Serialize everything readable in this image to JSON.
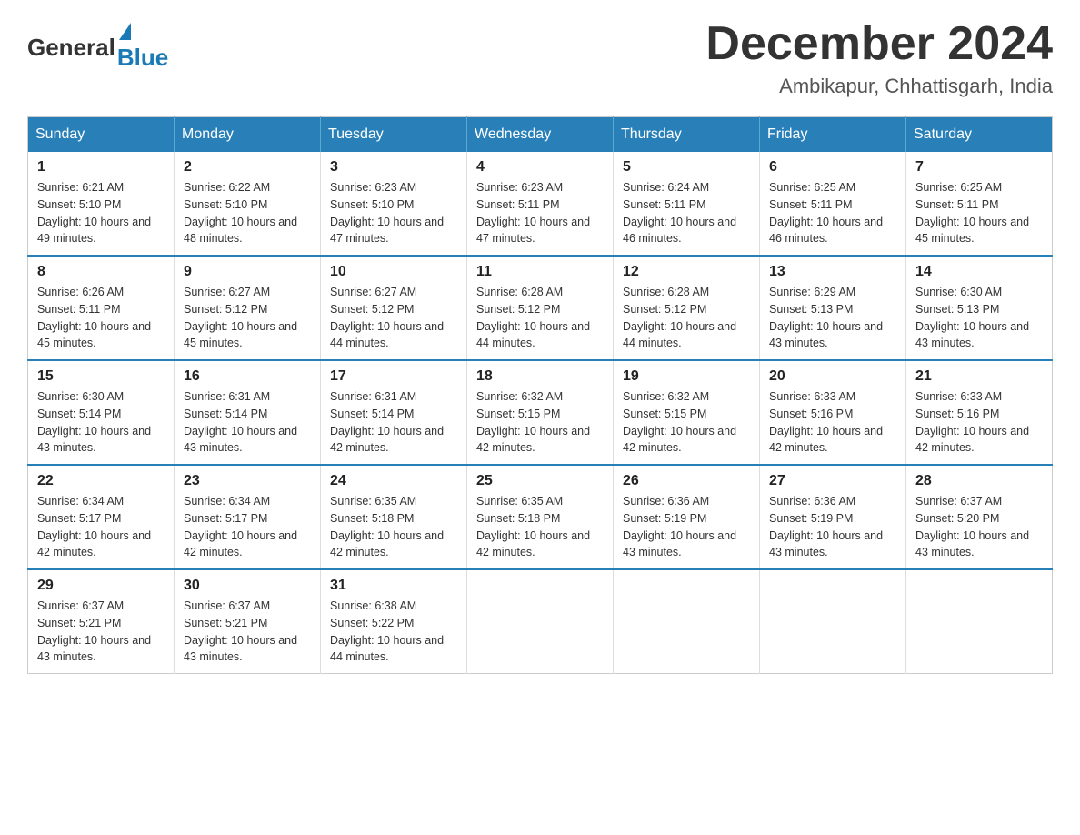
{
  "header": {
    "logo_general": "General",
    "logo_blue": "Blue",
    "month_title": "December 2024",
    "location": "Ambikapur, Chhattisgarh, India"
  },
  "weekdays": [
    "Sunday",
    "Monday",
    "Tuesday",
    "Wednesday",
    "Thursday",
    "Friday",
    "Saturday"
  ],
  "weeks": [
    [
      {
        "day": "1",
        "sunrise": "Sunrise: 6:21 AM",
        "sunset": "Sunset: 5:10 PM",
        "daylight": "Daylight: 10 hours and 49 minutes."
      },
      {
        "day": "2",
        "sunrise": "Sunrise: 6:22 AM",
        "sunset": "Sunset: 5:10 PM",
        "daylight": "Daylight: 10 hours and 48 minutes."
      },
      {
        "day": "3",
        "sunrise": "Sunrise: 6:23 AM",
        "sunset": "Sunset: 5:10 PM",
        "daylight": "Daylight: 10 hours and 47 minutes."
      },
      {
        "day": "4",
        "sunrise": "Sunrise: 6:23 AM",
        "sunset": "Sunset: 5:11 PM",
        "daylight": "Daylight: 10 hours and 47 minutes."
      },
      {
        "day": "5",
        "sunrise": "Sunrise: 6:24 AM",
        "sunset": "Sunset: 5:11 PM",
        "daylight": "Daylight: 10 hours and 46 minutes."
      },
      {
        "day": "6",
        "sunrise": "Sunrise: 6:25 AM",
        "sunset": "Sunset: 5:11 PM",
        "daylight": "Daylight: 10 hours and 46 minutes."
      },
      {
        "day": "7",
        "sunrise": "Sunrise: 6:25 AM",
        "sunset": "Sunset: 5:11 PM",
        "daylight": "Daylight: 10 hours and 45 minutes."
      }
    ],
    [
      {
        "day": "8",
        "sunrise": "Sunrise: 6:26 AM",
        "sunset": "Sunset: 5:11 PM",
        "daylight": "Daylight: 10 hours and 45 minutes."
      },
      {
        "day": "9",
        "sunrise": "Sunrise: 6:27 AM",
        "sunset": "Sunset: 5:12 PM",
        "daylight": "Daylight: 10 hours and 45 minutes."
      },
      {
        "day": "10",
        "sunrise": "Sunrise: 6:27 AM",
        "sunset": "Sunset: 5:12 PM",
        "daylight": "Daylight: 10 hours and 44 minutes."
      },
      {
        "day": "11",
        "sunrise": "Sunrise: 6:28 AM",
        "sunset": "Sunset: 5:12 PM",
        "daylight": "Daylight: 10 hours and 44 minutes."
      },
      {
        "day": "12",
        "sunrise": "Sunrise: 6:28 AM",
        "sunset": "Sunset: 5:12 PM",
        "daylight": "Daylight: 10 hours and 44 minutes."
      },
      {
        "day": "13",
        "sunrise": "Sunrise: 6:29 AM",
        "sunset": "Sunset: 5:13 PM",
        "daylight": "Daylight: 10 hours and 43 minutes."
      },
      {
        "day": "14",
        "sunrise": "Sunrise: 6:30 AM",
        "sunset": "Sunset: 5:13 PM",
        "daylight": "Daylight: 10 hours and 43 minutes."
      }
    ],
    [
      {
        "day": "15",
        "sunrise": "Sunrise: 6:30 AM",
        "sunset": "Sunset: 5:14 PM",
        "daylight": "Daylight: 10 hours and 43 minutes."
      },
      {
        "day": "16",
        "sunrise": "Sunrise: 6:31 AM",
        "sunset": "Sunset: 5:14 PM",
        "daylight": "Daylight: 10 hours and 43 minutes."
      },
      {
        "day": "17",
        "sunrise": "Sunrise: 6:31 AM",
        "sunset": "Sunset: 5:14 PM",
        "daylight": "Daylight: 10 hours and 42 minutes."
      },
      {
        "day": "18",
        "sunrise": "Sunrise: 6:32 AM",
        "sunset": "Sunset: 5:15 PM",
        "daylight": "Daylight: 10 hours and 42 minutes."
      },
      {
        "day": "19",
        "sunrise": "Sunrise: 6:32 AM",
        "sunset": "Sunset: 5:15 PM",
        "daylight": "Daylight: 10 hours and 42 minutes."
      },
      {
        "day": "20",
        "sunrise": "Sunrise: 6:33 AM",
        "sunset": "Sunset: 5:16 PM",
        "daylight": "Daylight: 10 hours and 42 minutes."
      },
      {
        "day": "21",
        "sunrise": "Sunrise: 6:33 AM",
        "sunset": "Sunset: 5:16 PM",
        "daylight": "Daylight: 10 hours and 42 minutes."
      }
    ],
    [
      {
        "day": "22",
        "sunrise": "Sunrise: 6:34 AM",
        "sunset": "Sunset: 5:17 PM",
        "daylight": "Daylight: 10 hours and 42 minutes."
      },
      {
        "day": "23",
        "sunrise": "Sunrise: 6:34 AM",
        "sunset": "Sunset: 5:17 PM",
        "daylight": "Daylight: 10 hours and 42 minutes."
      },
      {
        "day": "24",
        "sunrise": "Sunrise: 6:35 AM",
        "sunset": "Sunset: 5:18 PM",
        "daylight": "Daylight: 10 hours and 42 minutes."
      },
      {
        "day": "25",
        "sunrise": "Sunrise: 6:35 AM",
        "sunset": "Sunset: 5:18 PM",
        "daylight": "Daylight: 10 hours and 42 minutes."
      },
      {
        "day": "26",
        "sunrise": "Sunrise: 6:36 AM",
        "sunset": "Sunset: 5:19 PM",
        "daylight": "Daylight: 10 hours and 43 minutes."
      },
      {
        "day": "27",
        "sunrise": "Sunrise: 6:36 AM",
        "sunset": "Sunset: 5:19 PM",
        "daylight": "Daylight: 10 hours and 43 minutes."
      },
      {
        "day": "28",
        "sunrise": "Sunrise: 6:37 AM",
        "sunset": "Sunset: 5:20 PM",
        "daylight": "Daylight: 10 hours and 43 minutes."
      }
    ],
    [
      {
        "day": "29",
        "sunrise": "Sunrise: 6:37 AM",
        "sunset": "Sunset: 5:21 PM",
        "daylight": "Daylight: 10 hours and 43 minutes."
      },
      {
        "day": "30",
        "sunrise": "Sunrise: 6:37 AM",
        "sunset": "Sunset: 5:21 PM",
        "daylight": "Daylight: 10 hours and 43 minutes."
      },
      {
        "day": "31",
        "sunrise": "Sunrise: 6:38 AM",
        "sunset": "Sunset: 5:22 PM",
        "daylight": "Daylight: 10 hours and 44 minutes."
      },
      null,
      null,
      null,
      null
    ]
  ]
}
